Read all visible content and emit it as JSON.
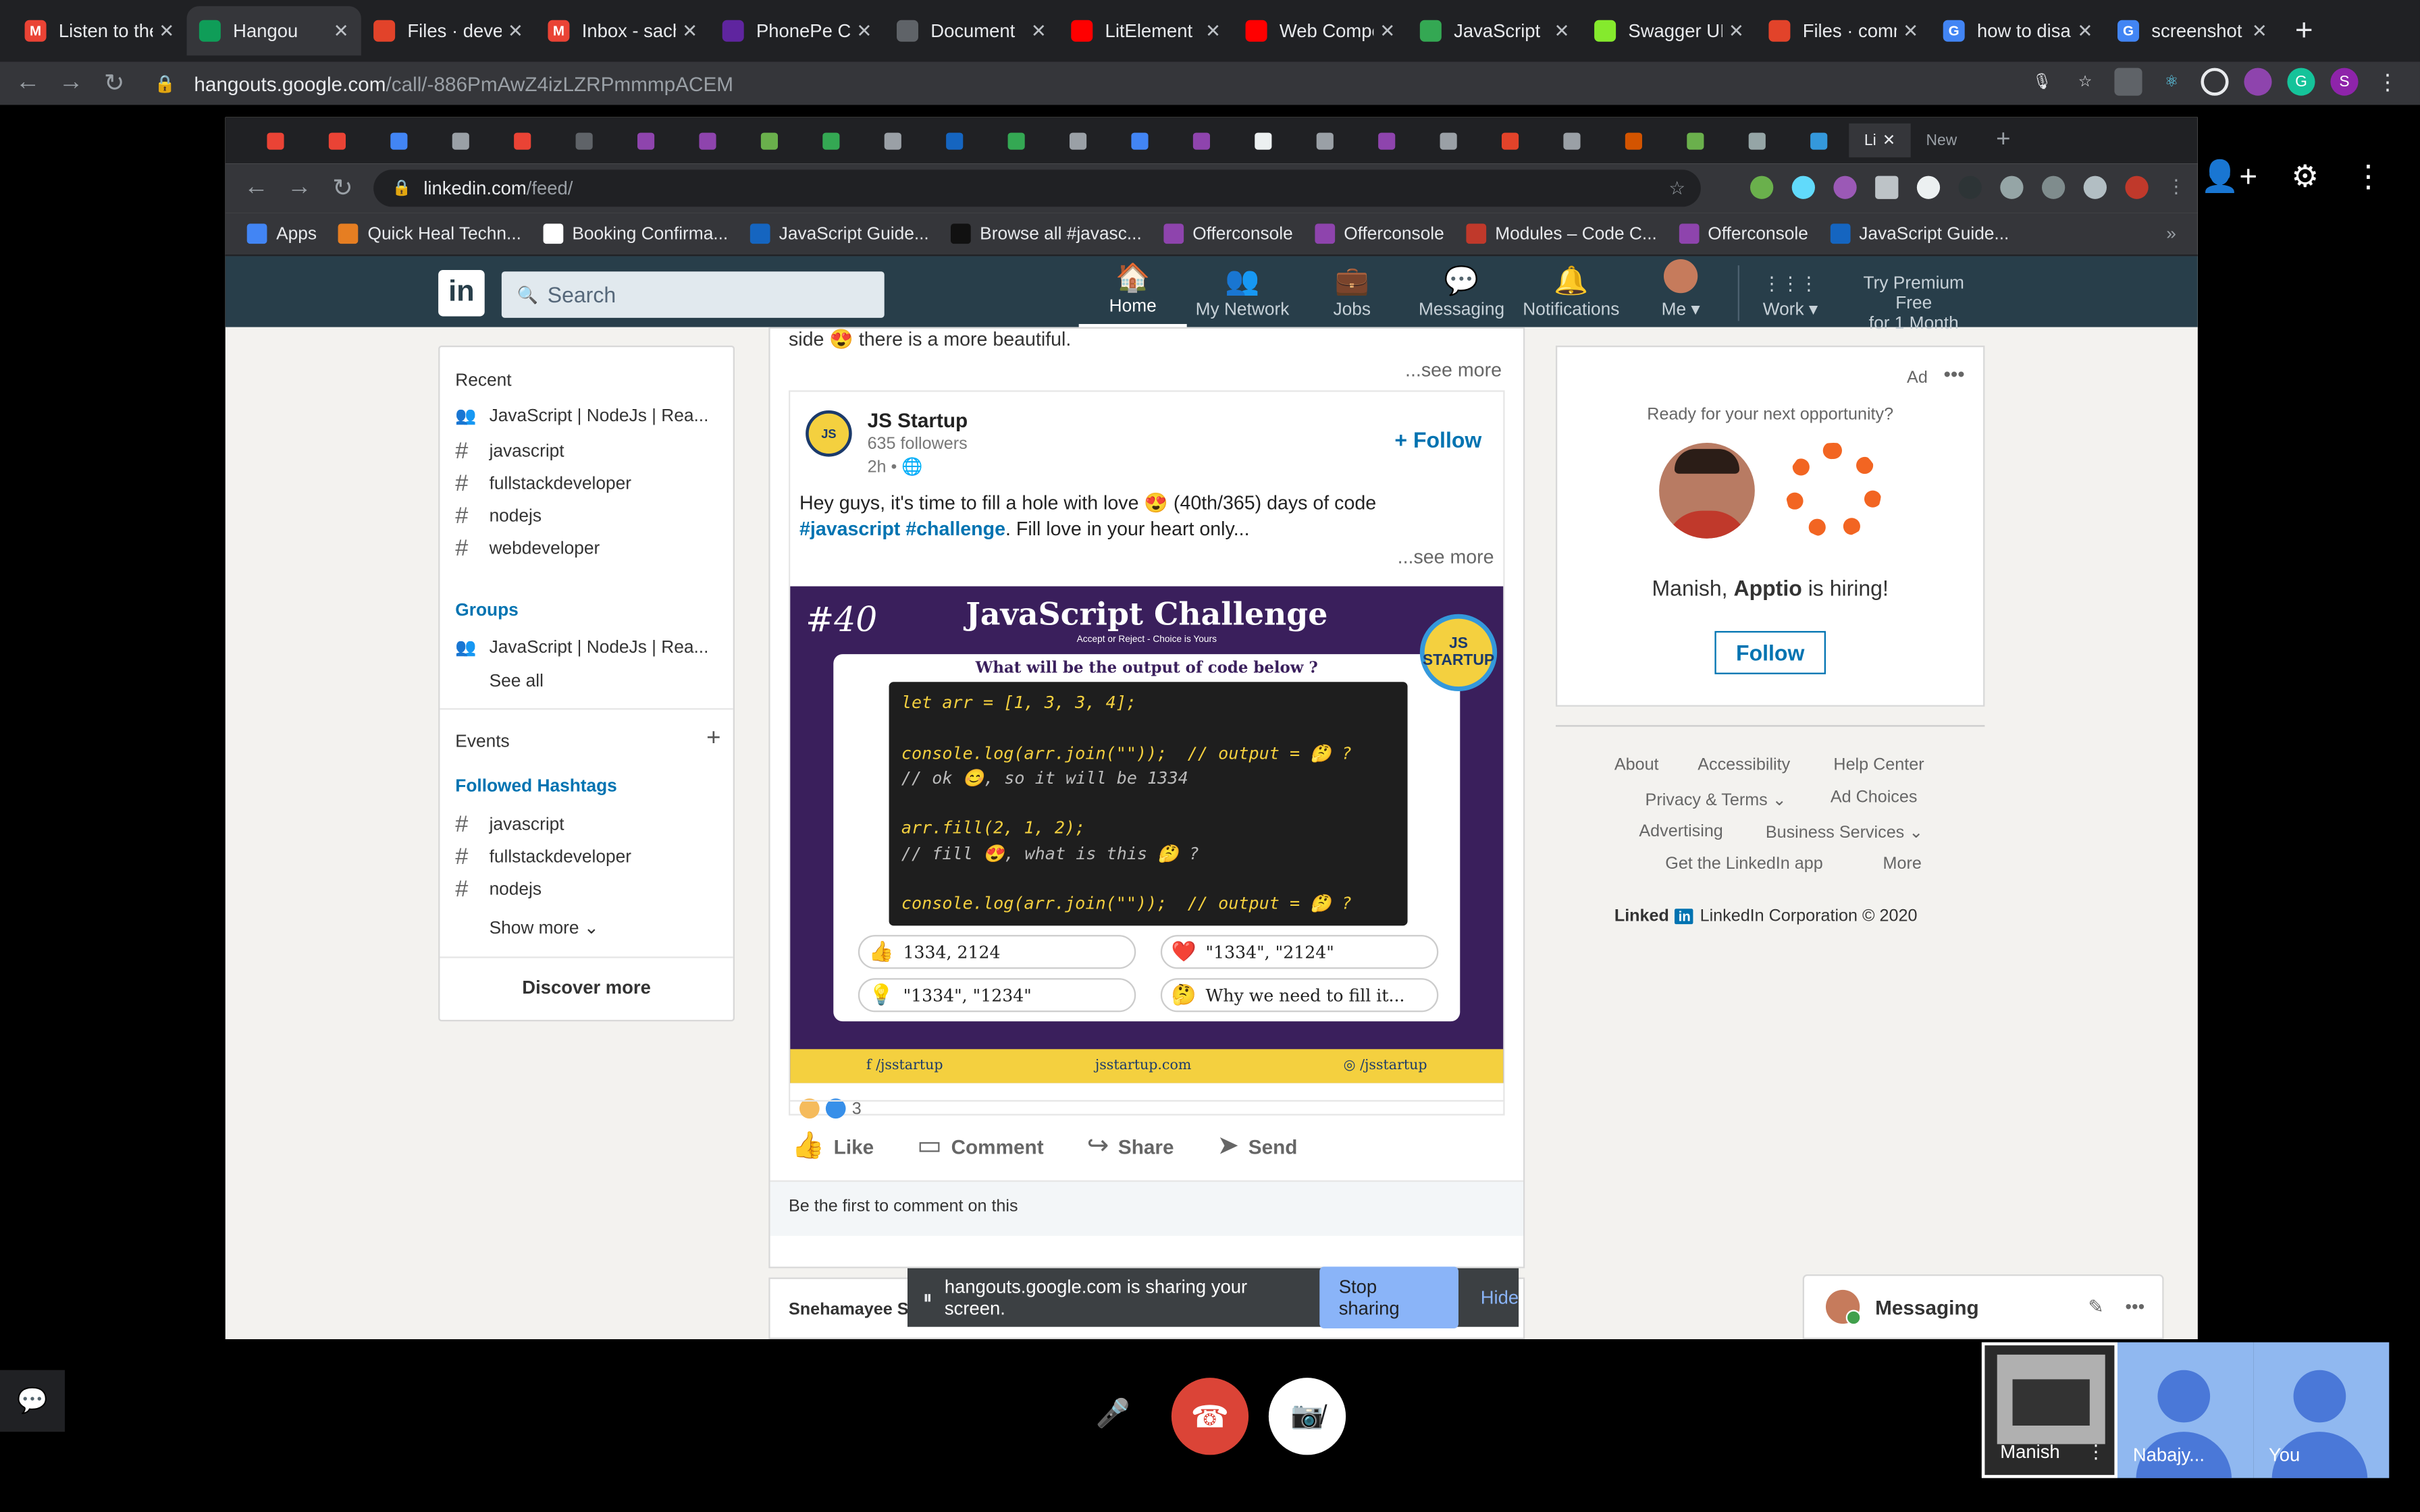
{
  "outer_browser": {
    "tabs": [
      {
        "title": "Listen to the",
        "fav_color": "#ea4335",
        "fav": "M"
      },
      {
        "title": "Hangou",
        "fav_color": "#0f9d58",
        "fav": "",
        "active": true
      },
      {
        "title": "Files · devel",
        "fav_color": "#e2432a",
        "fav": ""
      },
      {
        "title": "Inbox - sach",
        "fav_color": "#ea4335",
        "fav": "M"
      },
      {
        "title": "PhonePe Ch",
        "fav_color": "#5f259f",
        "fav": ""
      },
      {
        "title": "Document",
        "fav_color": "#5f6368",
        "fav": ""
      },
      {
        "title": "LitElement",
        "fav_color": "#ff0000",
        "fav": ""
      },
      {
        "title": "Web Compo",
        "fav_color": "#ff0000",
        "fav": ""
      },
      {
        "title": "JavaScript",
        "fav_color": "#34a853",
        "fav": ""
      },
      {
        "title": "Swagger UI",
        "fav_color": "#85ea2d",
        "fav": ""
      },
      {
        "title": "Files · comm",
        "fav_color": "#e2432a",
        "fav": ""
      },
      {
        "title": "how to disa",
        "fav_color": "#4285f4",
        "fav": "G"
      },
      {
        "title": "screenshot",
        "fav_color": "#4285f4",
        "fav": "G"
      }
    ],
    "url_host": "hangouts.google.com",
    "url_path": "/call/-886PmAwZ4izLZRPmmmpACEM",
    "profile_initial": "S"
  },
  "inner_browser": {
    "tab_count_label": "New",
    "active_tab_label": "Li",
    "url_host": "linkedin.com",
    "url_path": "/feed/",
    "bookmarks": [
      {
        "label": "Apps",
        "color": "#4285f4"
      },
      {
        "label": "Quick Heal Techn...",
        "color": "#e67e22"
      },
      {
        "label": "Booking Confirma...",
        "color": "#ffffff"
      },
      {
        "label": "JavaScript Guide...",
        "color": "#1565c0"
      },
      {
        "label": "Browse all #javasc...",
        "color": "#111111"
      },
      {
        "label": "Offerconsole",
        "color": "#8e44ad"
      },
      {
        "label": "Offerconsole",
        "color": "#8e44ad"
      },
      {
        "label": "Modules – Code C...",
        "color": "#c0392b"
      },
      {
        "label": "Offerconsole",
        "color": "#8e44ad"
      },
      {
        "label": "JavaScript Guide...",
        "color": "#1565c0"
      }
    ],
    "bookmarks_more": "»"
  },
  "linkedin": {
    "logo": "in",
    "search_placeholder": "Search",
    "nav": [
      {
        "label": "Home",
        "icon": "🏠"
      },
      {
        "label": "My Network",
        "icon": "👥"
      },
      {
        "label": "Jobs",
        "icon": "💼"
      },
      {
        "label": "Messaging",
        "icon": "💬"
      },
      {
        "label": "Notifications",
        "icon": "🔔"
      },
      {
        "label": "Me ▾",
        "icon": ""
      },
      {
        "label": "Work ▾",
        "icon": "⋮⋮⋮"
      }
    ],
    "premium_line1": "Try Premium Free",
    "premium_line2": "for 1 Month",
    "left": {
      "recent_heading": "Recent",
      "recent": [
        {
          "label": "JavaScript | NodeJs | Rea...",
          "icon": "group"
        },
        {
          "label": "javascript",
          "icon": "#"
        },
        {
          "label": "fullstackdeveloper",
          "icon": "#"
        },
        {
          "label": "nodejs",
          "icon": "#"
        },
        {
          "label": "webdeveloper",
          "icon": "#"
        }
      ],
      "groups_heading": "Groups",
      "group_item": "JavaScript | NodeJs | Rea...",
      "see_all": "See all",
      "events_heading": "Events",
      "followed_heading": "Followed Hashtags",
      "followed": [
        "javascript",
        "fullstackdeveloper",
        "nodejs"
      ],
      "show_more": "Show more ⌄",
      "discover": "Discover more"
    },
    "feed": {
      "prev_text": "side 😍 there is a more beautiful.",
      "see_more": "...see more",
      "post": {
        "author": "JS Startup",
        "followers": "635 followers",
        "time": "2h •",
        "follow": "+ Follow",
        "text_line1": "Hey guys, it's time to fill a hole with love 😍 (40th/365) days of code",
        "tag1": "#javascript",
        "tag2": "#challenge",
        "text_after_tags": ". Fill love in your heart only...",
        "see_more": "...see more",
        "image": {
          "number": "#40",
          "title": "JavaScript Challenge",
          "subtitle": "Accept or Reject - Choice is Yours",
          "badge": "JS STARTUP",
          "question": "What will be the output of code below ?",
          "code_lines": [
            "let arr = [1, 3, 3, 4];",
            "",
            "console.log(arr.join(\"\"));  // output = 🤔 ?",
            "// ok 😊, so it will be 1334",
            "",
            "arr.fill(2, 1, 2);",
            "// fill 😍, what is this 🤔 ?",
            "",
            "console.log(arr.join(\"\"));  // output = 🤔 ?"
          ],
          "options": [
            {
              "icon": "👍",
              "text": "1334, 2124"
            },
            {
              "icon": "❤️",
              "text": "\"1334\", \"2124\""
            },
            {
              "icon": "💡",
              "text": "\"1334\", \"1234\""
            },
            {
              "icon": "🤔",
              "text": "Why we need to fill it..."
            }
          ],
          "footer": [
            "f /jsstartup",
            "jsstartup.com",
            "◎ /jsstartup"
          ]
        },
        "reactions_count": "3",
        "actions": [
          {
            "label": "Like",
            "icon": "👍"
          },
          {
            "label": "Comment",
            "icon": "▭"
          },
          {
            "label": "Share",
            "icon": "↪"
          },
          {
            "label": "Send",
            "icon": "➤"
          }
        ],
        "first_comment": "Be the first to comment on this"
      },
      "next_post_author": "Snehamayee S"
    },
    "right": {
      "ad_label": "Ad",
      "ad_question": "Ready for your next opportunity?",
      "hiring_name": "Manish, ",
      "hiring_company": "Apptio",
      "hiring_suffix": " is hiring!",
      "follow": "Follow",
      "footer": {
        "about": "About",
        "accessibility": "Accessibility",
        "help": "Help Center",
        "privacy": "Privacy & Terms ⌄",
        "adchoices": "Ad Choices",
        "advertising": "Advertising",
        "business": "Business Services ⌄",
        "app": "Get the LinkedIn app",
        "more": "More"
      },
      "corp_brand": "Linked",
      "corp_in": "in",
      "corp_text": "LinkedIn Corporation © 2020"
    },
    "messaging": "Messaging"
  },
  "sharebar": {
    "text": "hangouts.google.com is sharing your screen.",
    "stop": "Stop sharing",
    "hide": "Hide"
  },
  "hangouts": {
    "participants": [
      "Manish",
      "Nabajy...",
      "You"
    ]
  }
}
